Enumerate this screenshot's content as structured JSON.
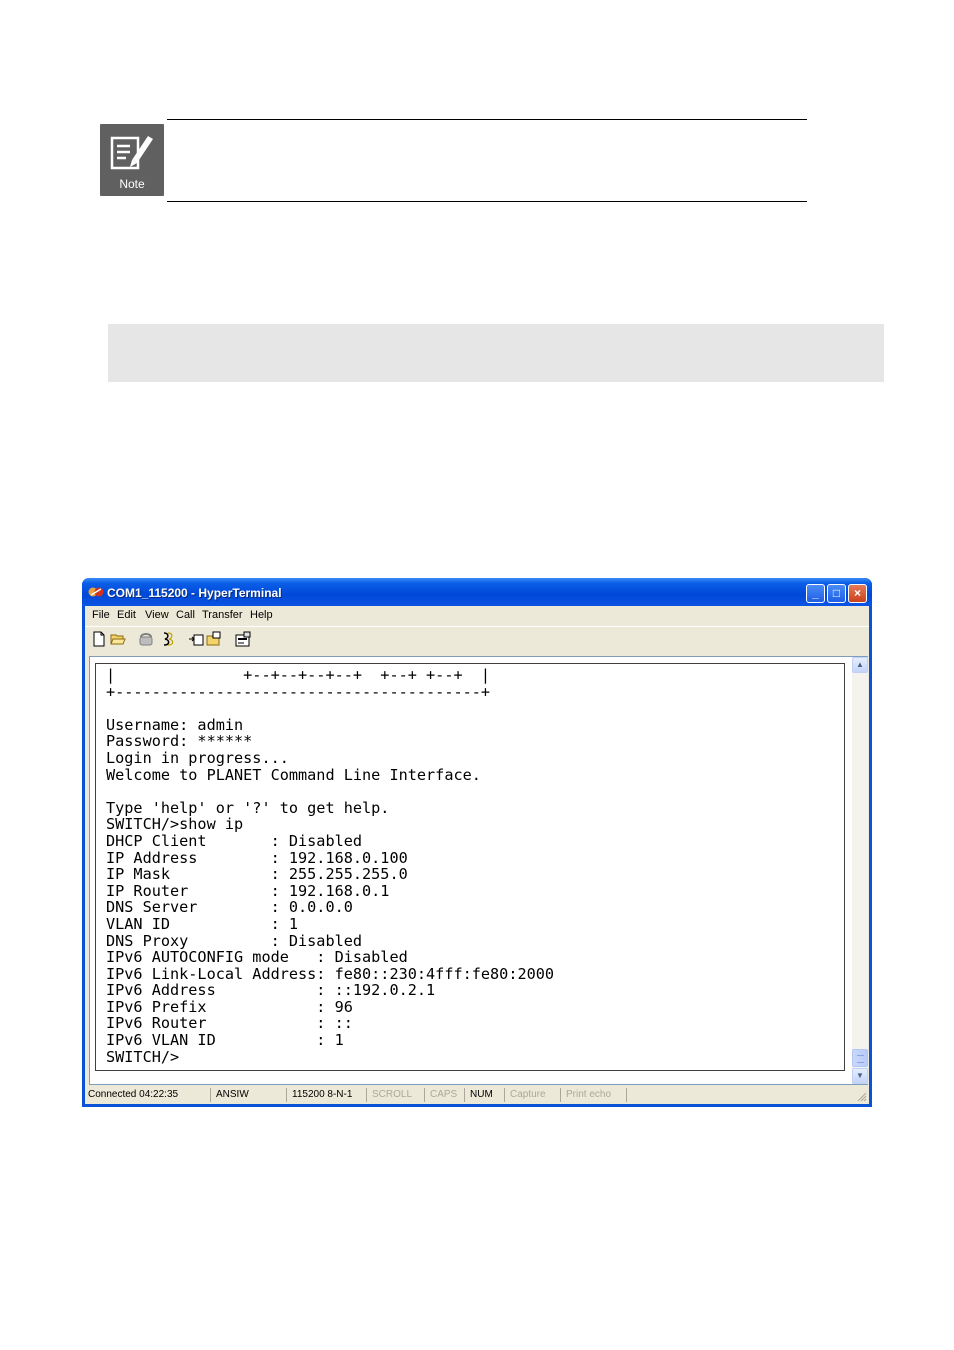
{
  "note": {
    "label": "Note"
  },
  "window": {
    "title": "COM1_115200 - HyperTerminal",
    "controls": {
      "minimize": "_",
      "maximize": "□",
      "close": "×"
    }
  },
  "menu": [
    "File",
    "Edit",
    "View",
    "Call",
    "Transfer",
    "Help"
  ],
  "toolbar": [
    {
      "icon": "new-connection-icon"
    },
    {
      "icon": "open-folder-icon"
    },
    {
      "icon": "connect-phone-icon"
    },
    {
      "icon": "disconnect-icon"
    },
    {
      "icon": "send-file-icon"
    },
    {
      "icon": "receive-file-icon"
    },
    {
      "icon": "properties-icon"
    }
  ],
  "terminal": {
    "lines": [
      "|              +--+--+--+--+  +--+ +--+  |",
      "+----------------------------------------+",
      "",
      "Username: admin",
      "Password: ******",
      "Login in progress...",
      "Welcome to PLANET Command Line Interface.",
      "",
      "Type 'help' or '?' to get help.",
      "SWITCH/>show ip",
      "DHCP Client       : Disabled",
      "IP Address        : 192.168.0.100",
      "IP Mask           : 255.255.255.0",
      "IP Router         : 192.168.0.1",
      "DNS Server        : 0.0.0.0",
      "VLAN ID           : 1",
      "DNS Proxy         : Disabled",
      "IPv6 AUTOCONFIG mode   : Disabled",
      "IPv6 Link-Local Address: fe80::230:4fff:fe80:2000",
      "IPv6 Address           : ::192.0.2.1",
      "IPv6 Prefix            : 96",
      "IPv6 Router            : ::",
      "IPv6 VLAN ID           : 1",
      "SWITCH/>"
    ]
  },
  "statusbar": {
    "connected": "Connected 04:22:35",
    "emulation": "ANSIW",
    "settings": "115200 8-N-1",
    "scroll": "SCROLL",
    "caps": "CAPS",
    "num": "NUM",
    "capture": "Capture",
    "print_echo": "Print echo"
  }
}
